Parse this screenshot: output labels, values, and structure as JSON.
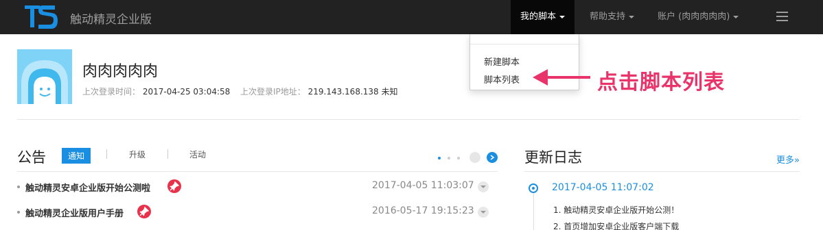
{
  "nav": {
    "brand": "触动精灵企业版",
    "my_scripts": "我的脚本",
    "help": "帮助支持",
    "account": "账户 (肉肉肉肉肉)",
    "dropdown": [
      "新建脚本",
      "脚本列表"
    ]
  },
  "annotation": "点击脚本列表",
  "profile": {
    "username": "肉肉肉肉肉",
    "last_login_label": "上次登录时间：",
    "last_login_value": "2017-04-25 03:04:58",
    "last_ip_label": "上次登录IP地址：",
    "last_ip_value": "219.143.168.138 未知"
  },
  "notices": {
    "title": "公告",
    "tabs": [
      "通知",
      "升级",
      "活动"
    ],
    "items": [
      {
        "title": "触动精灵安卓企业版开始公测啦",
        "date": "2017-04-05 11:03:07"
      },
      {
        "title": "触动精灵企业版用户手册",
        "date": "2016-05-17 19:15:23"
      }
    ]
  },
  "changelog": {
    "title": "更新日志",
    "more": "更多»",
    "date": "2017-04-05 11:07:02",
    "items": [
      "1. 触动精灵安卓企业版开始公测！",
      "2. 首页增加安卓企业版客户端下载"
    ]
  },
  "colors": {
    "topbar": "#222222",
    "accent": "#1a8ee0",
    "annotation": "#e8336b",
    "pin": "#e8314a"
  }
}
